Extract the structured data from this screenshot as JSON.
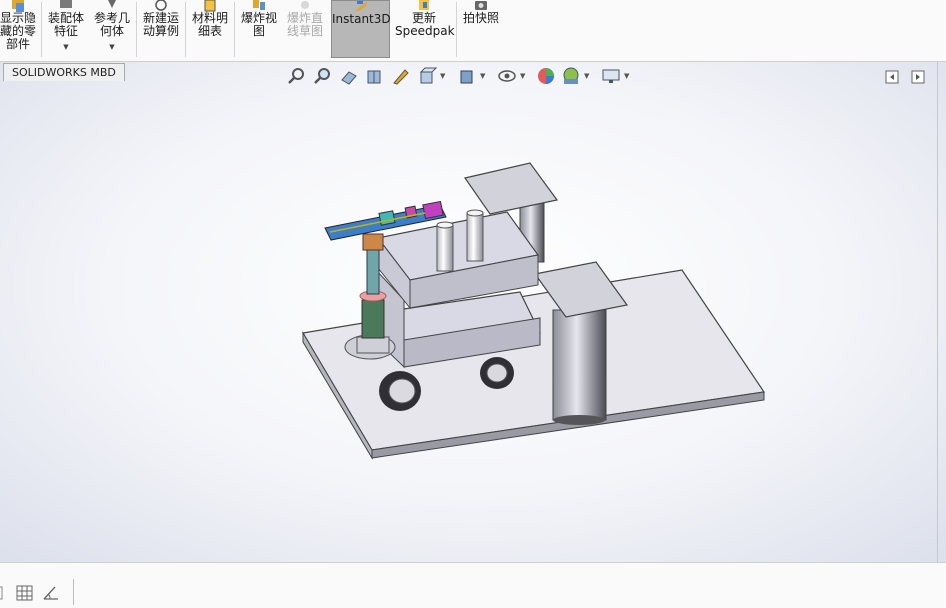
{
  "ribbon": {
    "buttons": [
      {
        "id": "show-hidden",
        "label": "显示隐\n藏的零\n部件",
        "disabled": false,
        "active": false,
        "dropdown": false
      },
      {
        "id": "assembly-features",
        "label": "装配体\n特征",
        "disabled": false,
        "active": false,
        "dropdown": true
      },
      {
        "id": "reference-geometry",
        "label": "参考几\n何体",
        "disabled": false,
        "active": false,
        "dropdown": true
      },
      {
        "id": "new-motion-study",
        "label": "新建运\n动算例",
        "disabled": false,
        "active": false,
        "dropdown": false
      },
      {
        "id": "bill-of-materials",
        "label": "材料明\n细表",
        "disabled": false,
        "active": false,
        "dropdown": false
      },
      {
        "id": "exploded-view",
        "label": "爆炸视\n图",
        "disabled": false,
        "active": false,
        "dropdown": false
      },
      {
        "id": "explode-line-sketch",
        "label": "爆炸直\n线草图",
        "disabled": true,
        "active": false,
        "dropdown": false
      },
      {
        "id": "instant3d",
        "label": "Instant3D",
        "disabled": false,
        "active": true,
        "dropdown": false
      },
      {
        "id": "update-speedpak",
        "label": "更新\nSpeedpak",
        "disabled": false,
        "active": false,
        "dropdown": false
      },
      {
        "id": "snapshot",
        "label": "拍快照",
        "disabled": false,
        "active": false,
        "dropdown": false
      }
    ]
  },
  "tabs": {
    "mbd_label": "SOLIDWORKS MBD"
  },
  "hud": {
    "icons": [
      "zoom-to-fit-icon",
      "zoom-to-area-icon",
      "previous-view-icon",
      "section-view-icon",
      "dynamic-annotation-icon",
      "view-orientation-icon",
      "display-style-icon",
      "hide-show-items-icon",
      "edit-appearance-icon",
      "apply-scene-icon",
      "view-settings-icon"
    ]
  },
  "colors": {
    "accent": "#b7b7b7",
    "plate": "#e8e8ee",
    "cart": "#d9d9e6"
  }
}
